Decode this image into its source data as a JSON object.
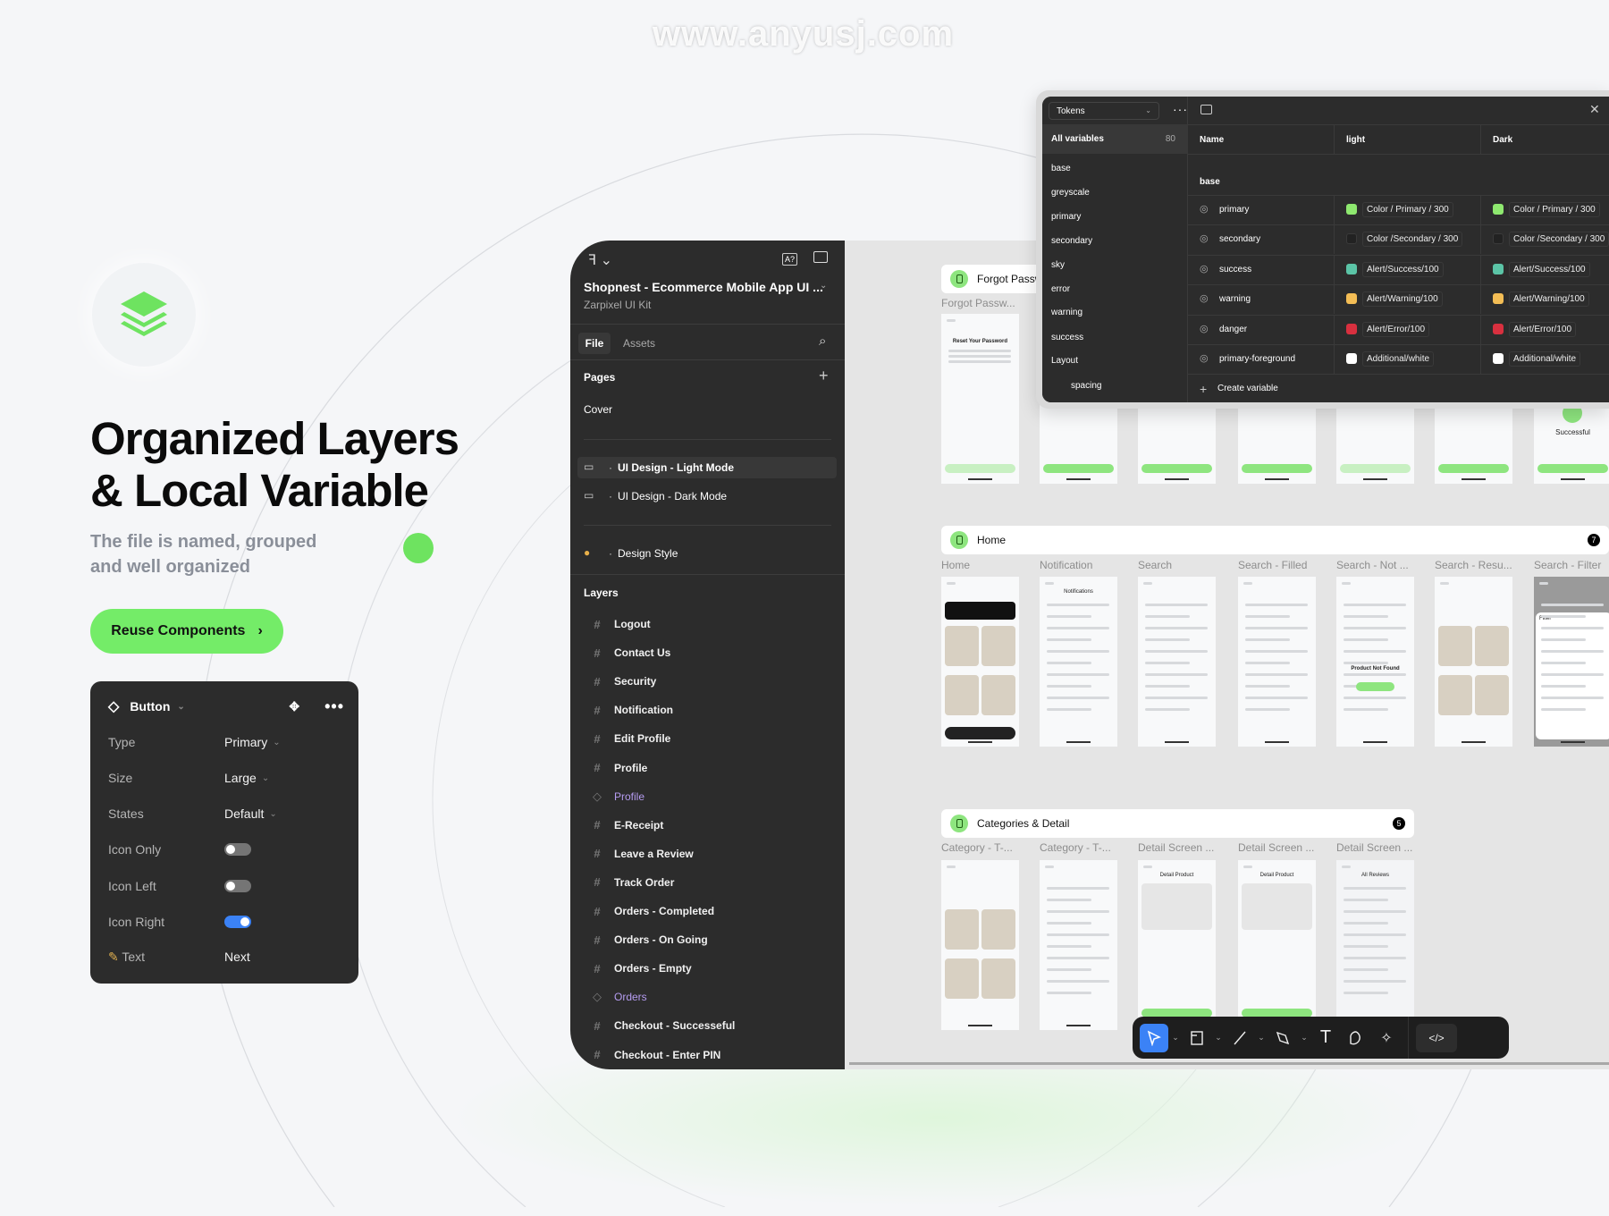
{
  "watermark": "www.anyusj.com",
  "hero": {
    "title_line1": "Organized Layers",
    "title_line2": "& Local Variable",
    "subtitle_line1": "The file is named, grouped",
    "subtitle_line2": "and well organized",
    "cta_label": "Reuse Components",
    "accent": "#74ec68"
  },
  "component_panel": {
    "name": "Button",
    "props": [
      {
        "label": "Type",
        "value": "Primary",
        "kind": "select"
      },
      {
        "label": "Size",
        "value": "Large",
        "kind": "select"
      },
      {
        "label": "States",
        "value": "Default",
        "kind": "select"
      },
      {
        "label": "Icon Only",
        "value": false,
        "kind": "toggle"
      },
      {
        "label": "Icon Left",
        "value": false,
        "kind": "toggle"
      },
      {
        "label": "Icon Right",
        "value": true,
        "kind": "toggle"
      },
      {
        "label": "Text",
        "value": "Next",
        "kind": "text"
      }
    ]
  },
  "file_panel": {
    "file_title": "Shopnest - Ecommerce Mobile App UI ...",
    "team": "Zarpixel UI Kit",
    "tabs": [
      "File",
      "Assets"
    ],
    "pages_label": "Pages",
    "pages": [
      {
        "label": "Cover",
        "icon": "none"
      },
      {
        "label": "UI Design - Light Mode",
        "icon": "monitor-icon",
        "selected": true
      },
      {
        "label": "UI Design - Dark Mode",
        "icon": "monitor-icon"
      },
      {
        "label": "Design Style",
        "icon": "palette-icon"
      }
    ],
    "layers_label": "Layers",
    "layers": [
      {
        "label": "Logout",
        "type": "frame"
      },
      {
        "label": "Contact Us",
        "type": "frame"
      },
      {
        "label": "Security",
        "type": "frame"
      },
      {
        "label": "Notification",
        "type": "frame"
      },
      {
        "label": "Edit Profile",
        "type": "frame"
      },
      {
        "label": "Profile",
        "type": "frame"
      },
      {
        "label": "Profile",
        "type": "component"
      },
      {
        "label": "E-Receipt",
        "type": "frame"
      },
      {
        "label": "Leave a Review",
        "type": "frame"
      },
      {
        "label": "Track Order",
        "type": "frame"
      },
      {
        "label": "Orders - Completed",
        "type": "frame"
      },
      {
        "label": "Orders - On Going",
        "type": "frame"
      },
      {
        "label": "Orders - Empty",
        "type": "frame"
      },
      {
        "label": "Orders",
        "type": "component"
      },
      {
        "label": "Checkout - Successeful",
        "type": "frame"
      },
      {
        "label": "Checkout - Enter PIN",
        "type": "frame"
      }
    ]
  },
  "variables_panel": {
    "collection": "Tokens",
    "all_label": "All variables",
    "count": "80",
    "groups": [
      "base",
      "greyscale",
      "primary",
      "secondary",
      "sky",
      "error",
      "warning",
      "success",
      "Layout",
      "spacing"
    ],
    "columns": [
      "Name",
      "light",
      "Dark"
    ],
    "group_title": "base",
    "rows": [
      {
        "name": "primary",
        "light": "Color / Primary / 300",
        "dark": "Color / Primary / 300",
        "color": "#8ee86f"
      },
      {
        "name": "secondary",
        "light": "Color /Secondary / 300",
        "dark": "Color /Secondary / 300",
        "color": "#222222"
      },
      {
        "name": "success",
        "light": "Alert/Success/100",
        "dark": "Alert/Success/100",
        "color": "#5bc4a6"
      },
      {
        "name": "warning",
        "light": "Alert/Warning/100",
        "dark": "Alert/Warning/100",
        "color": "#f3bd55"
      },
      {
        "name": "danger",
        "light": "Alert/Error/100",
        "dark": "Alert/Error/100",
        "color": "#d8303f"
      },
      {
        "name": "primary-foreground",
        "light": "Additional/white",
        "dark": "Additional/white",
        "color": "#ffffff"
      }
    ],
    "create_label": "Create variable"
  },
  "canvas": {
    "sections": [
      {
        "title": "Forgot Password",
        "frames": [
          "Forgot Passw..."
        ],
        "thumb_texts": [
          "Reset Your Password",
          "Successful"
        ]
      },
      {
        "title": "Home",
        "badge": "7",
        "frames": [
          "Home",
          "Notification",
          "Search",
          "Search - Filled",
          "Search - Not ...",
          "Search - Resu...",
          "Search - Filter"
        ],
        "thumb_texts": [
          "Notifications",
          "Product Not Found",
          "Filter"
        ]
      },
      {
        "title": "Categories & Detail",
        "badge": "5",
        "frames": [
          "Category - T-...",
          "Category - T-...",
          "Detail Screen ...",
          "Detail Screen ...",
          "Detail Screen ..."
        ],
        "thumb_texts": [
          "Detail Product",
          "All Reviews"
        ]
      }
    ]
  },
  "toolbar": {
    "tools": [
      "move-tool",
      "frame-tool",
      "line-tool",
      "pen-tool",
      "text-tool",
      "comment-tool",
      "ai-tool",
      "dev-mode-toggle"
    ],
    "selected": "move-tool"
  }
}
